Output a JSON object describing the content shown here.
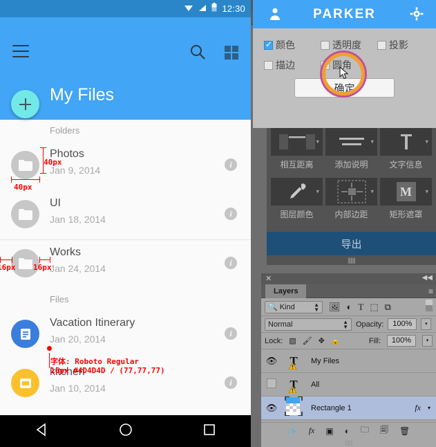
{
  "phone": {
    "statusbar": {
      "time": "12:30",
      "icons": [
        "wifi-icon",
        "signal-icon",
        "battery-icon"
      ]
    },
    "appbar": {
      "menu_icon": "hamburger-icon",
      "search_icon": "search-icon",
      "grid_icon": "grid-view-icon",
      "title": "My Files"
    },
    "fab": {
      "label": "+",
      "icon": "add-icon",
      "color": "#72e8e8"
    },
    "sections": [
      {
        "label": "Folders",
        "items": [
          {
            "name": "Photos",
            "date": "Jan 9, 2014",
            "icon": "folder-icon",
            "color": "#c7c7c7"
          },
          {
            "name": "UI",
            "date": "Jan 18, 2014",
            "icon": "folder-icon",
            "color": "#c7c7c7"
          },
          {
            "name": "Works",
            "date": "Jan 24, 2014",
            "icon": "folder-icon",
            "color": "#c7c7c7"
          }
        ]
      },
      {
        "label": "Files",
        "items": [
          {
            "name": "Vacation Itinerary",
            "date": "Jan 20, 2014",
            "icon": "document-icon",
            "color": "#3b7ddd"
          },
          {
            "name": "kitchen",
            "date": "Jan 10, 2014",
            "icon": "image-icon",
            "color": "#fbc02d"
          }
        ]
      }
    ],
    "navbar": {
      "back": "back-triangle-icon",
      "home": "home-circle-icon",
      "recents": "recents-square-icon"
    }
  },
  "annotations": [
    {
      "text": "40px",
      "kind": "height-measure"
    },
    {
      "text": "40px",
      "kind": "width-measure"
    },
    {
      "text": "16px",
      "kind": "gap-measure-left"
    },
    {
      "text": "16px",
      "kind": "gap-measure-right"
    },
    {
      "text": "字体: Roboto Regular",
      "kind": "font-spec-line1"
    },
    {
      "text": "16px #4D4D4D / (77,77,77)",
      "kind": "font-spec-line2"
    }
  ],
  "photoshop": {
    "window_tab": "Parker",
    "collapse_icon": "collapse-icon",
    "close_icon": "close-icon",
    "panel_menu_icon": "panel-menu-icon",
    "parker": {
      "logo": "PARKER",
      "user_icon": "user-icon",
      "gear_icon": "gear-icon",
      "checkboxes": [
        {
          "label": "颜色",
          "checked": true
        },
        {
          "label": "透明度",
          "checked": false
        },
        {
          "label": "投影",
          "checked": false
        },
        {
          "label": "描边",
          "checked": false
        },
        {
          "label": "圆角",
          "checked": false
        }
      ],
      "confirm_button": "确定"
    },
    "tools": {
      "items": [
        {
          "label": "相互距离",
          "icon": "spacing-icon"
        },
        {
          "label": "添加说明",
          "icon": "note-lines-icon"
        },
        {
          "label": "文字信息",
          "icon": "text-info-icon"
        },
        {
          "label": "图层颜色",
          "icon": "eyedropper-icon"
        },
        {
          "label": "内部边距",
          "icon": "padding-icon"
        },
        {
          "label": "矩形遮罩",
          "icon": "mask-m-icon"
        }
      ],
      "export_button": "导出"
    },
    "layers": {
      "tab": "Layers",
      "filter_kind": "Kind",
      "filter_icons": [
        "pixel-filter-icon",
        "adjustment-filter-icon",
        "type-filter-icon",
        "shape-filter-icon",
        "smart-object-filter-icon"
      ],
      "blend_mode": "Normal",
      "opacity_label": "Opacity:",
      "opacity_value": "100%",
      "lock_label": "Lock:",
      "lock_icons": [
        "lock-transparency-icon",
        "lock-image-icon",
        "lock-position-icon",
        "lock-all-icon"
      ],
      "fill_label": "Fill:",
      "fill_value": "100%",
      "rows": [
        {
          "name": "My Files",
          "visible": true,
          "type": "text-layer",
          "selected": false,
          "warning": true,
          "fx": false
        },
        {
          "name": "All",
          "visible": false,
          "type": "text-layer",
          "selected": false,
          "warning": true,
          "fx": false
        },
        {
          "name": "Rectangle 1",
          "visible": true,
          "type": "shape-layer",
          "selected": true,
          "warning": false,
          "fx": true
        }
      ],
      "footer_icons": [
        "link-icon",
        "fx-icon",
        "mask-icon",
        "adjustment-icon",
        "group-icon",
        "new-layer-icon",
        "delete-icon"
      ]
    }
  }
}
